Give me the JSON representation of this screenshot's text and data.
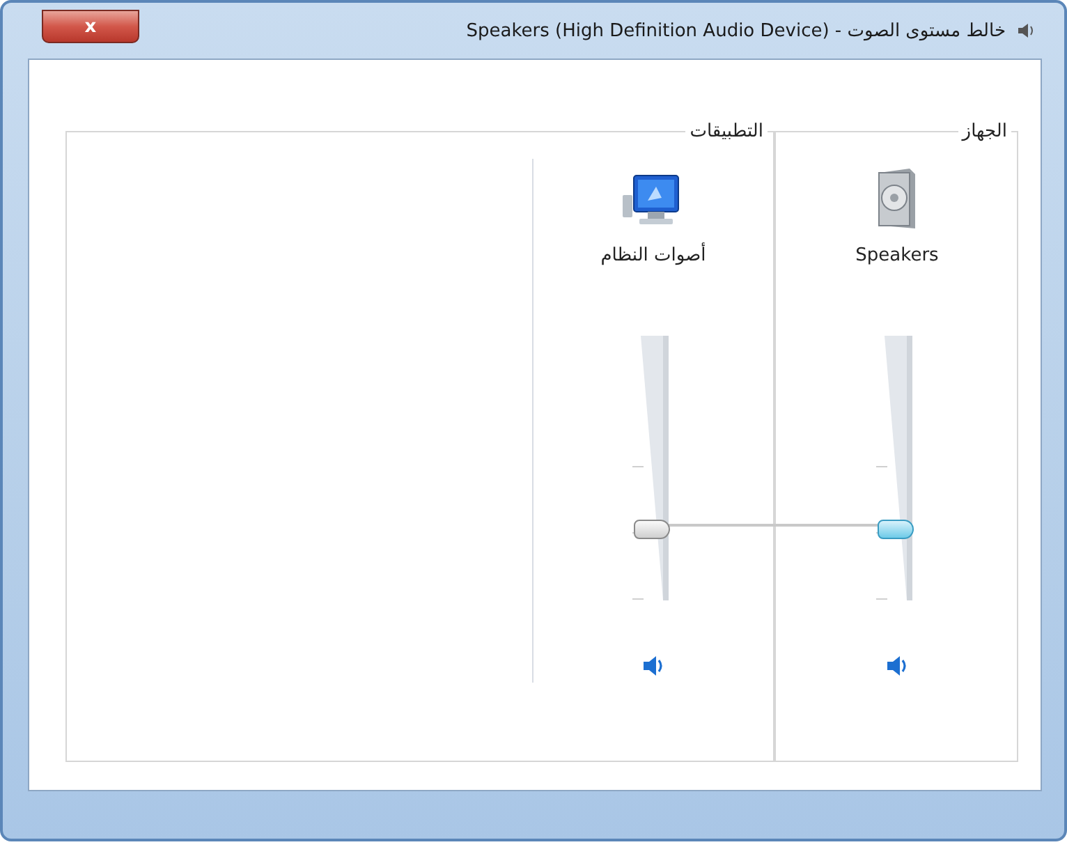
{
  "window": {
    "title": "خالط مستوى الصوت - Speakers (High Definition Audio Device)",
    "close_label": "x"
  },
  "device": {
    "label": "الجهاز",
    "channels": [
      {
        "kind": "speakers",
        "name": "Speakers",
        "level": 0.27,
        "selected": true,
        "muted": false
      }
    ]
  },
  "applications": {
    "label": "التطبيقات",
    "channels": [
      {
        "kind": "system-sounds",
        "name": "أصوات النظام",
        "level": 0.27,
        "selected": false,
        "muted": false
      }
    ]
  }
}
